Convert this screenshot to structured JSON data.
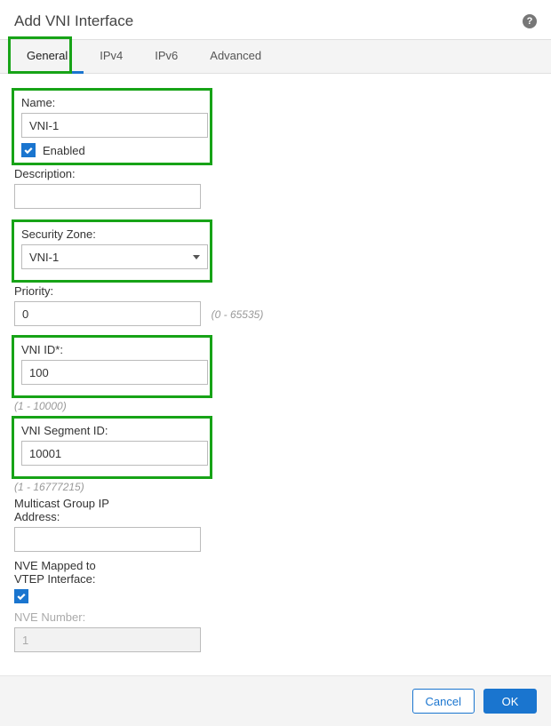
{
  "header": {
    "title": "Add VNI Interface"
  },
  "tabs": {
    "general": "General",
    "ipv4": "IPv4",
    "ipv6": "IPv6",
    "advanced": "Advanced"
  },
  "form": {
    "name_label": "Name:",
    "name_value": "VNI-1",
    "enabled_label": "Enabled",
    "description_label": "Description:",
    "description_value": "",
    "security_zone_label": "Security Zone:",
    "security_zone_value": "VNI-1",
    "priority_label": "Priority:",
    "priority_value": "0",
    "priority_hint": "(0 - 65535)",
    "vni_id_label": "VNI ID*:",
    "vni_id_value": "100",
    "vni_id_hint": "(1 - 10000)",
    "segment_id_label": "VNI Segment ID:",
    "segment_id_value": "10001",
    "segment_id_hint": "(1 - 16777215)",
    "multicast_label": "Multicast Group IP Address:",
    "multicast_value": "",
    "nve_mapped_label": "NVE Mapped to VTEP Interface:",
    "nve_number_label": "NVE Number:",
    "nve_number_value": "1"
  },
  "footer": {
    "cancel": "Cancel",
    "ok": "OK"
  }
}
